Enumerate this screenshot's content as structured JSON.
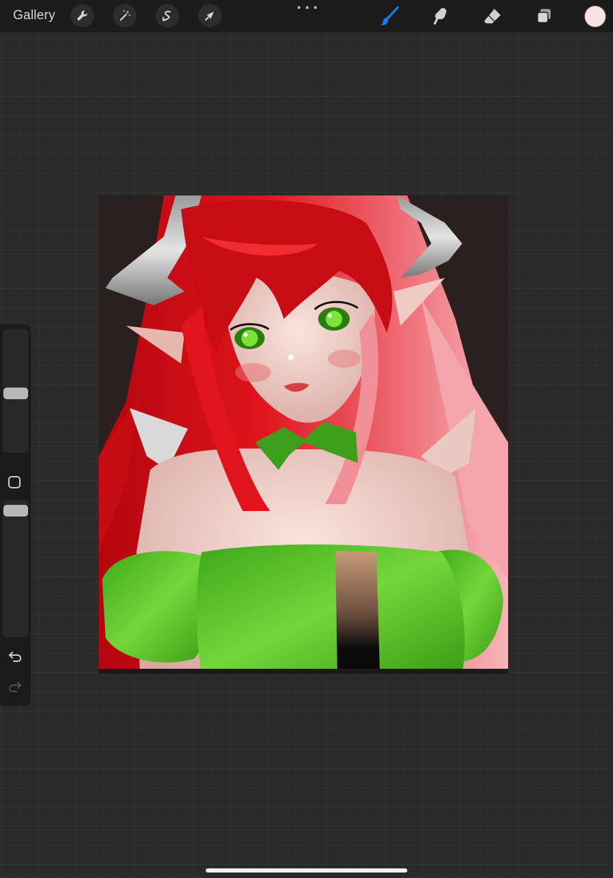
{
  "topbar": {
    "gallery_label": "Gallery",
    "left_tools": [
      "wrench-icon",
      "magic-wand-icon",
      "selection-icon",
      "transform-arrow-icon"
    ],
    "right_tools": [
      "brush-icon",
      "smudge-icon",
      "eraser-icon",
      "layers-icon"
    ],
    "active_tool": "brush-icon",
    "current_color": "#f9e3e3"
  },
  "sidebar": {
    "brush_size_level": 0.48,
    "opacity_level": 0.96,
    "buttons": [
      "modify-square-icon",
      "undo-icon",
      "redo-icon"
    ]
  },
  "colors": {
    "accent": "#1a7cf5",
    "canvas_background": "#2b1f1f",
    "workspace": "#2a2a2a"
  }
}
